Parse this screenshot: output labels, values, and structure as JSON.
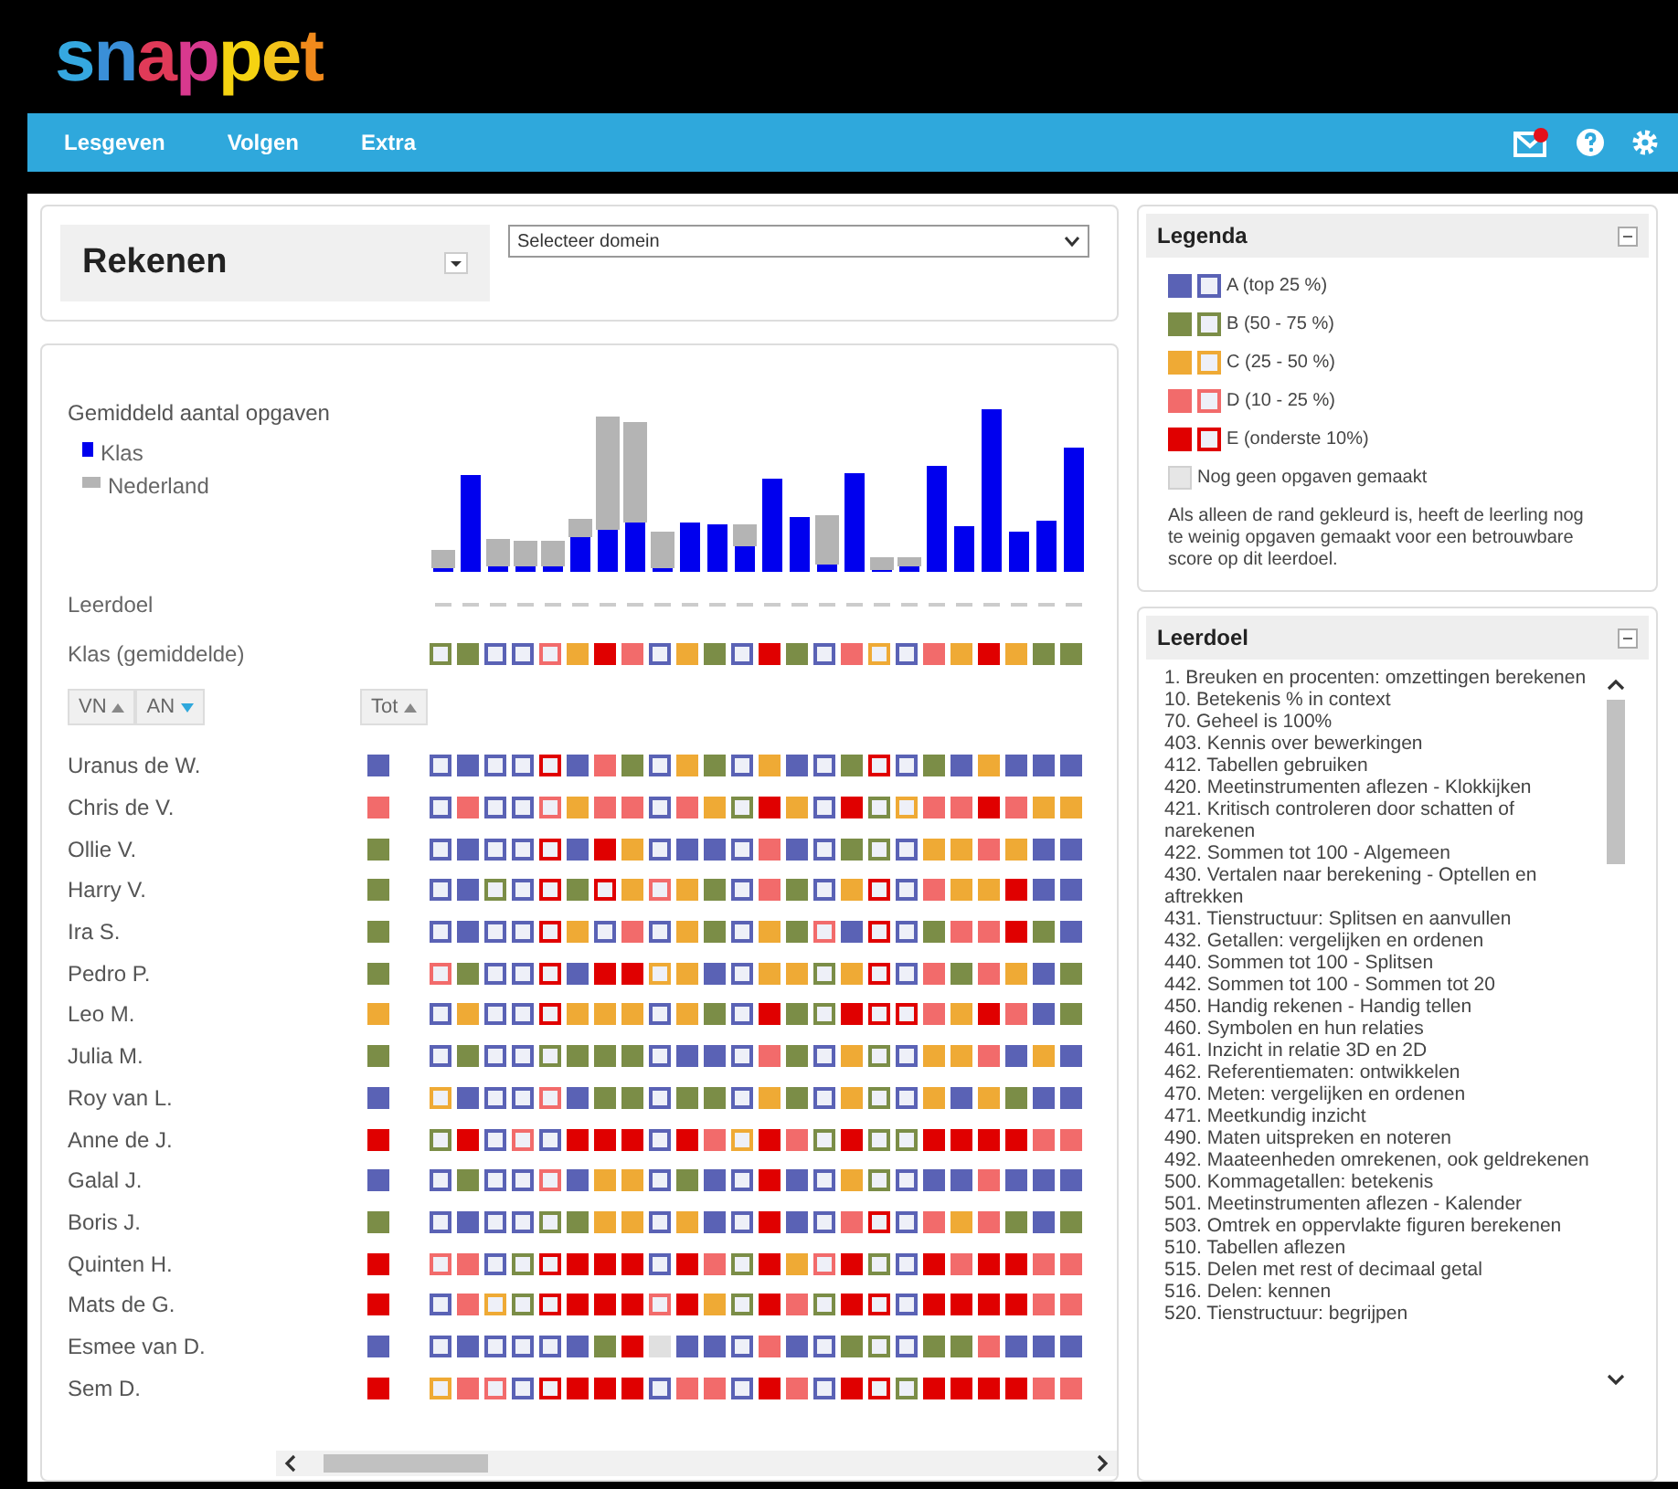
{
  "logo": "snappet",
  "nav": [
    {
      "label": "Lesgeven"
    },
    {
      "label": "Volgen"
    },
    {
      "label": "Extra"
    }
  ],
  "subject": {
    "title": "Rekenen"
  },
  "domain_select": {
    "value": "Selecteer domein"
  },
  "chart_legend": {
    "title": "Gemiddeld aantal opgaven",
    "series": [
      {
        "name": "Klas",
        "color": "#0000ee"
      },
      {
        "name": "Nederland",
        "color": "#b4b4b4"
      }
    ]
  },
  "row_labels": {
    "goal": "Leerdoel",
    "class_avg": "Klas (gemiddelde)"
  },
  "class_avg": [
    {
      "color": "#7b8d47",
      "filled": false
    },
    {
      "color": "#7b8d47",
      "filled": true
    },
    {
      "color": "#5a62b5",
      "filled": false
    },
    {
      "color": "#5a62b5",
      "filled": false
    },
    {
      "color": "#f26b6b",
      "filled": false
    },
    {
      "color": "#efaa35",
      "filled": true
    },
    {
      "color": "#e00000",
      "filled": true
    },
    {
      "color": "#f26b6b",
      "filled": true
    },
    {
      "color": "#5a62b5",
      "filled": false
    },
    {
      "color": "#efaa35",
      "filled": true
    },
    {
      "color": "#7b8d47",
      "filled": true
    },
    {
      "color": "#5a62b5",
      "filled": false
    },
    {
      "color": "#e00000",
      "filled": true
    },
    {
      "color": "#7b8d47",
      "filled": true
    },
    {
      "color": "#5a62b5",
      "filled": false
    },
    {
      "color": "#f26b6b",
      "filled": true
    },
    {
      "color": "#efaa35",
      "filled": false
    },
    {
      "color": "#5a62b5",
      "filled": false
    },
    {
      "color": "#f26b6b",
      "filled": true
    },
    {
      "color": "#efaa35",
      "filled": true
    },
    {
      "color": "#e00000",
      "filled": true
    },
    {
      "color": "#efaa35",
      "filled": true
    },
    {
      "color": "#7b8d47",
      "filled": true
    },
    {
      "color": "#7b8d47",
      "filled": true
    }
  ],
  "sort_buttons": [
    {
      "label": "VN",
      "selected": false
    },
    {
      "label": "AN",
      "selected": true
    }
  ],
  "total_header": "Tot",
  "students": [
    {
      "name": "Uranus de W.",
      "total": {
        "color": "#5a62b5"
      },
      "cells": [
        {
          "color": "#5a62b5",
          "filled": false
        },
        {
          "color": "#5a62b5",
          "filled": true
        },
        {
          "color": "#5a62b5",
          "filled": false
        },
        {
          "color": "#5a62b5",
          "filled": false
        },
        {
          "color": "#e00000",
          "filled": false
        },
        {
          "color": "#5a62b5",
          "filled": true
        },
        {
          "color": "#f26b6b",
          "filled": true
        },
        {
          "color": "#7b8d47",
          "filled": true
        },
        {
          "color": "#5a62b5",
          "filled": false
        },
        {
          "color": "#efaa35",
          "filled": true
        },
        {
          "color": "#7b8d47",
          "filled": true
        },
        {
          "color": "#5a62b5",
          "filled": false
        },
        {
          "color": "#efaa35",
          "filled": true
        },
        {
          "color": "#5a62b5",
          "filled": true
        },
        {
          "color": "#5a62b5",
          "filled": false
        },
        {
          "color": "#7b8d47",
          "filled": true
        },
        {
          "color": "#e00000",
          "filled": false
        },
        {
          "color": "#5a62b5",
          "filled": false
        },
        {
          "color": "#7b8d47",
          "filled": true
        },
        {
          "color": "#5a62b5",
          "filled": true
        },
        {
          "color": "#efaa35",
          "filled": true
        },
        {
          "color": "#5a62b5",
          "filled": true
        },
        {
          "color": "#5a62b5",
          "filled": true
        },
        {
          "color": "#5a62b5",
          "filled": true
        }
      ]
    },
    {
      "name": "Chris de V.",
      "total": {
        "color": "#f26b6b"
      },
      "cells": [
        {
          "color": "#5a62b5",
          "filled": false
        },
        {
          "color": "#f26b6b",
          "filled": true
        },
        {
          "color": "#5a62b5",
          "filled": false
        },
        {
          "color": "#5a62b5",
          "filled": false
        },
        {
          "color": "#f26b6b",
          "filled": false
        },
        {
          "color": "#efaa35",
          "filled": true
        },
        {
          "color": "#f26b6b",
          "filled": true
        },
        {
          "color": "#f26b6b",
          "filled": true
        },
        {
          "color": "#5a62b5",
          "filled": false
        },
        {
          "color": "#f26b6b",
          "filled": true
        },
        {
          "color": "#efaa35",
          "filled": true
        },
        {
          "color": "#7b8d47",
          "filled": false
        },
        {
          "color": "#e00000",
          "filled": true
        },
        {
          "color": "#efaa35",
          "filled": true
        },
        {
          "color": "#5a62b5",
          "filled": false
        },
        {
          "color": "#e00000",
          "filled": true
        },
        {
          "color": "#7b8d47",
          "filled": false
        },
        {
          "color": "#efaa35",
          "filled": false
        },
        {
          "color": "#f26b6b",
          "filled": true
        },
        {
          "color": "#f26b6b",
          "filled": true
        },
        {
          "color": "#e00000",
          "filled": true
        },
        {
          "color": "#f26b6b",
          "filled": true
        },
        {
          "color": "#efaa35",
          "filled": true
        },
        {
          "color": "#efaa35",
          "filled": true
        }
      ]
    },
    {
      "name": "Ollie V.",
      "total": {
        "color": "#7b8d47"
      },
      "cells": [
        {
          "color": "#5a62b5",
          "filled": false
        },
        {
          "color": "#5a62b5",
          "filled": true
        },
        {
          "color": "#5a62b5",
          "filled": false
        },
        {
          "color": "#5a62b5",
          "filled": false
        },
        {
          "color": "#e00000",
          "filled": false
        },
        {
          "color": "#5a62b5",
          "filled": true
        },
        {
          "color": "#e00000",
          "filled": true
        },
        {
          "color": "#efaa35",
          "filled": true
        },
        {
          "color": "#5a62b5",
          "filled": false
        },
        {
          "color": "#5a62b5",
          "filled": true
        },
        {
          "color": "#5a62b5",
          "filled": true
        },
        {
          "color": "#5a62b5",
          "filled": false
        },
        {
          "color": "#f26b6b",
          "filled": true
        },
        {
          "color": "#5a62b5",
          "filled": true
        },
        {
          "color": "#5a62b5",
          "filled": false
        },
        {
          "color": "#7b8d47",
          "filled": true
        },
        {
          "color": "#7b8d47",
          "filled": false
        },
        {
          "color": "#5a62b5",
          "filled": false
        },
        {
          "color": "#efaa35",
          "filled": true
        },
        {
          "color": "#efaa35",
          "filled": true
        },
        {
          "color": "#f26b6b",
          "filled": true
        },
        {
          "color": "#efaa35",
          "filled": true
        },
        {
          "color": "#5a62b5",
          "filled": true
        },
        {
          "color": "#5a62b5",
          "filled": true
        }
      ]
    },
    {
      "name": "Harry V.",
      "total": {
        "color": "#7b8d47"
      },
      "cells": [
        {
          "color": "#5a62b5",
          "filled": false
        },
        {
          "color": "#5a62b5",
          "filled": true
        },
        {
          "color": "#7b8d47",
          "filled": false
        },
        {
          "color": "#5a62b5",
          "filled": false
        },
        {
          "color": "#e00000",
          "filled": false
        },
        {
          "color": "#7b8d47",
          "filled": true
        },
        {
          "color": "#e00000",
          "filled": false
        },
        {
          "color": "#efaa35",
          "filled": true
        },
        {
          "color": "#f26b6b",
          "filled": false
        },
        {
          "color": "#efaa35",
          "filled": true
        },
        {
          "color": "#7b8d47",
          "filled": true
        },
        {
          "color": "#5a62b5",
          "filled": false
        },
        {
          "color": "#f26b6b",
          "filled": true
        },
        {
          "color": "#7b8d47",
          "filled": true
        },
        {
          "color": "#5a62b5",
          "filled": false
        },
        {
          "color": "#efaa35",
          "filled": true
        },
        {
          "color": "#e00000",
          "filled": false
        },
        {
          "color": "#5a62b5",
          "filled": false
        },
        {
          "color": "#f26b6b",
          "filled": true
        },
        {
          "color": "#efaa35",
          "filled": true
        },
        {
          "color": "#efaa35",
          "filled": true
        },
        {
          "color": "#e00000",
          "filled": true
        },
        {
          "color": "#5a62b5",
          "filled": true
        },
        {
          "color": "#5a62b5",
          "filled": true
        }
      ]
    },
    {
      "name": "Ira S.",
      "total": {
        "color": "#7b8d47"
      },
      "cells": [
        {
          "color": "#5a62b5",
          "filled": false
        },
        {
          "color": "#5a62b5",
          "filled": true
        },
        {
          "color": "#5a62b5",
          "filled": false
        },
        {
          "color": "#5a62b5",
          "filled": false
        },
        {
          "color": "#e00000",
          "filled": false
        },
        {
          "color": "#efaa35",
          "filled": true
        },
        {
          "color": "#5a62b5",
          "filled": false
        },
        {
          "color": "#f26b6b",
          "filled": true
        },
        {
          "color": "#5a62b5",
          "filled": false
        },
        {
          "color": "#efaa35",
          "filled": true
        },
        {
          "color": "#7b8d47",
          "filled": true
        },
        {
          "color": "#5a62b5",
          "filled": false
        },
        {
          "color": "#efaa35",
          "filled": true
        },
        {
          "color": "#7b8d47",
          "filled": true
        },
        {
          "color": "#f26b6b",
          "filled": false
        },
        {
          "color": "#5a62b5",
          "filled": true
        },
        {
          "color": "#e00000",
          "filled": false
        },
        {
          "color": "#5a62b5",
          "filled": false
        },
        {
          "color": "#7b8d47",
          "filled": true
        },
        {
          "color": "#f26b6b",
          "filled": true
        },
        {
          "color": "#f26b6b",
          "filled": true
        },
        {
          "color": "#e00000",
          "filled": true
        },
        {
          "color": "#7b8d47",
          "filled": true
        },
        {
          "color": "#5a62b5",
          "filled": true
        }
      ]
    },
    {
      "name": "Pedro P.",
      "total": {
        "color": "#7b8d47"
      },
      "cells": [
        {
          "color": "#f26b6b",
          "filled": false
        },
        {
          "color": "#7b8d47",
          "filled": true
        },
        {
          "color": "#5a62b5",
          "filled": false
        },
        {
          "color": "#5a62b5",
          "filled": false
        },
        {
          "color": "#e00000",
          "filled": false
        },
        {
          "color": "#5a62b5",
          "filled": true
        },
        {
          "color": "#e00000",
          "filled": true
        },
        {
          "color": "#e00000",
          "filled": true
        },
        {
          "color": "#efaa35",
          "filled": false
        },
        {
          "color": "#efaa35",
          "filled": true
        },
        {
          "color": "#5a62b5",
          "filled": true
        },
        {
          "color": "#5a62b5",
          "filled": false
        },
        {
          "color": "#efaa35",
          "filled": true
        },
        {
          "color": "#efaa35",
          "filled": true
        },
        {
          "color": "#7b8d47",
          "filled": false
        },
        {
          "color": "#efaa35",
          "filled": true
        },
        {
          "color": "#e00000",
          "filled": false
        },
        {
          "color": "#5a62b5",
          "filled": false
        },
        {
          "color": "#f26b6b",
          "filled": true
        },
        {
          "color": "#7b8d47",
          "filled": true
        },
        {
          "color": "#f26b6b",
          "filled": true
        },
        {
          "color": "#efaa35",
          "filled": true
        },
        {
          "color": "#5a62b5",
          "filled": true
        },
        {
          "color": "#7b8d47",
          "filled": true
        }
      ]
    },
    {
      "name": "Leo M.",
      "total": {
        "color": "#efaa35"
      },
      "cells": [
        {
          "color": "#5a62b5",
          "filled": false
        },
        {
          "color": "#efaa35",
          "filled": true
        },
        {
          "color": "#5a62b5",
          "filled": false
        },
        {
          "color": "#5a62b5",
          "filled": false
        },
        {
          "color": "#e00000",
          "filled": false
        },
        {
          "color": "#efaa35",
          "filled": true
        },
        {
          "color": "#efaa35",
          "filled": true
        },
        {
          "color": "#efaa35",
          "filled": true
        },
        {
          "color": "#5a62b5",
          "filled": false
        },
        {
          "color": "#efaa35",
          "filled": true
        },
        {
          "color": "#7b8d47",
          "filled": true
        },
        {
          "color": "#5a62b5",
          "filled": false
        },
        {
          "color": "#e00000",
          "filled": true
        },
        {
          "color": "#7b8d47",
          "filled": true
        },
        {
          "color": "#7b8d47",
          "filled": false
        },
        {
          "color": "#e00000",
          "filled": true
        },
        {
          "color": "#e00000",
          "filled": false
        },
        {
          "color": "#e00000",
          "filled": false
        },
        {
          "color": "#f26b6b",
          "filled": true
        },
        {
          "color": "#efaa35",
          "filled": true
        },
        {
          "color": "#e00000",
          "filled": true
        },
        {
          "color": "#f26b6b",
          "filled": true
        },
        {
          "color": "#5a62b5",
          "filled": true
        },
        {
          "color": "#7b8d47",
          "filled": true
        }
      ]
    },
    {
      "name": "Julia M.",
      "total": {
        "color": "#7b8d47"
      },
      "cells": [
        {
          "color": "#5a62b5",
          "filled": false
        },
        {
          "color": "#7b8d47",
          "filled": true
        },
        {
          "color": "#5a62b5",
          "filled": false
        },
        {
          "color": "#5a62b5",
          "filled": false
        },
        {
          "color": "#7b8d47",
          "filled": false
        },
        {
          "color": "#7b8d47",
          "filled": true
        },
        {
          "color": "#7b8d47",
          "filled": true
        },
        {
          "color": "#7b8d47",
          "filled": true
        },
        {
          "color": "#5a62b5",
          "filled": false
        },
        {
          "color": "#5a62b5",
          "filled": true
        },
        {
          "color": "#5a62b5",
          "filled": true
        },
        {
          "color": "#5a62b5",
          "filled": false
        },
        {
          "color": "#f26b6b",
          "filled": true
        },
        {
          "color": "#7b8d47",
          "filled": true
        },
        {
          "color": "#5a62b5",
          "filled": false
        },
        {
          "color": "#efaa35",
          "filled": true
        },
        {
          "color": "#7b8d47",
          "filled": false
        },
        {
          "color": "#5a62b5",
          "filled": false
        },
        {
          "color": "#efaa35",
          "filled": true
        },
        {
          "color": "#efaa35",
          "filled": true
        },
        {
          "color": "#f26b6b",
          "filled": true
        },
        {
          "color": "#5a62b5",
          "filled": true
        },
        {
          "color": "#efaa35",
          "filled": true
        },
        {
          "color": "#5a62b5",
          "filled": true
        }
      ]
    },
    {
      "name": "Roy van L.",
      "total": {
        "color": "#5a62b5"
      },
      "cells": [
        {
          "color": "#efaa35",
          "filled": false
        },
        {
          "color": "#5a62b5",
          "filled": true
        },
        {
          "color": "#5a62b5",
          "filled": false
        },
        {
          "color": "#5a62b5",
          "filled": false
        },
        {
          "color": "#f26b6b",
          "filled": false
        },
        {
          "color": "#5a62b5",
          "filled": true
        },
        {
          "color": "#7b8d47",
          "filled": true
        },
        {
          "color": "#7b8d47",
          "filled": true
        },
        {
          "color": "#5a62b5",
          "filled": false
        },
        {
          "color": "#7b8d47",
          "filled": true
        },
        {
          "color": "#7b8d47",
          "filled": true
        },
        {
          "color": "#5a62b5",
          "filled": false
        },
        {
          "color": "#efaa35",
          "filled": true
        },
        {
          "color": "#7b8d47",
          "filled": true
        },
        {
          "color": "#5a62b5",
          "filled": false
        },
        {
          "color": "#efaa35",
          "filled": true
        },
        {
          "color": "#7b8d47",
          "filled": false
        },
        {
          "color": "#5a62b5",
          "filled": false
        },
        {
          "color": "#efaa35",
          "filled": true
        },
        {
          "color": "#5a62b5",
          "filled": true
        },
        {
          "color": "#efaa35",
          "filled": true
        },
        {
          "color": "#7b8d47",
          "filled": true
        },
        {
          "color": "#5a62b5",
          "filled": true
        },
        {
          "color": "#5a62b5",
          "filled": true
        }
      ]
    },
    {
      "name": "Anne de J.",
      "total": {
        "color": "#e00000"
      },
      "cells": [
        {
          "color": "#7b8d47",
          "filled": false
        },
        {
          "color": "#e00000",
          "filled": true
        },
        {
          "color": "#5a62b5",
          "filled": false
        },
        {
          "color": "#f26b6b",
          "filled": false
        },
        {
          "color": "#5a62b5",
          "filled": false
        },
        {
          "color": "#e00000",
          "filled": true
        },
        {
          "color": "#e00000",
          "filled": true
        },
        {
          "color": "#e00000",
          "filled": true
        },
        {
          "color": "#5a62b5",
          "filled": false
        },
        {
          "color": "#e00000",
          "filled": true
        },
        {
          "color": "#f26b6b",
          "filled": true
        },
        {
          "color": "#efaa35",
          "filled": false
        },
        {
          "color": "#e00000",
          "filled": true
        },
        {
          "color": "#f26b6b",
          "filled": true
        },
        {
          "color": "#7b8d47",
          "filled": false
        },
        {
          "color": "#e00000",
          "filled": true
        },
        {
          "color": "#7b8d47",
          "filled": false
        },
        {
          "color": "#7b8d47",
          "filled": false
        },
        {
          "color": "#e00000",
          "filled": true
        },
        {
          "color": "#e00000",
          "filled": true
        },
        {
          "color": "#e00000",
          "filled": true
        },
        {
          "color": "#e00000",
          "filled": true
        },
        {
          "color": "#f26b6b",
          "filled": true
        },
        {
          "color": "#f26b6b",
          "filled": true
        }
      ]
    },
    {
      "name": "Galal J.",
      "total": {
        "color": "#5a62b5"
      },
      "cells": [
        {
          "color": "#5a62b5",
          "filled": false
        },
        {
          "color": "#7b8d47",
          "filled": true
        },
        {
          "color": "#5a62b5",
          "filled": false
        },
        {
          "color": "#5a62b5",
          "filled": false
        },
        {
          "color": "#f26b6b",
          "filled": false
        },
        {
          "color": "#5a62b5",
          "filled": true
        },
        {
          "color": "#efaa35",
          "filled": true
        },
        {
          "color": "#efaa35",
          "filled": true
        },
        {
          "color": "#5a62b5",
          "filled": false
        },
        {
          "color": "#7b8d47",
          "filled": true
        },
        {
          "color": "#5a62b5",
          "filled": true
        },
        {
          "color": "#5a62b5",
          "filled": false
        },
        {
          "color": "#e00000",
          "filled": true
        },
        {
          "color": "#5a62b5",
          "filled": true
        },
        {
          "color": "#5a62b5",
          "filled": false
        },
        {
          "color": "#efaa35",
          "filled": true
        },
        {
          "color": "#7b8d47",
          "filled": false
        },
        {
          "color": "#5a62b5",
          "filled": false
        },
        {
          "color": "#5a62b5",
          "filled": true
        },
        {
          "color": "#5a62b5",
          "filled": true
        },
        {
          "color": "#f26b6b",
          "filled": true
        },
        {
          "color": "#5a62b5",
          "filled": true
        },
        {
          "color": "#5a62b5",
          "filled": true
        },
        {
          "color": "#5a62b5",
          "filled": true
        }
      ]
    },
    {
      "name": "Boris J.",
      "total": {
        "color": "#7b8d47"
      },
      "cells": [
        {
          "color": "#5a62b5",
          "filled": false
        },
        {
          "color": "#5a62b5",
          "filled": true
        },
        {
          "color": "#5a62b5",
          "filled": false
        },
        {
          "color": "#5a62b5",
          "filled": false
        },
        {
          "color": "#7b8d47",
          "filled": false
        },
        {
          "color": "#7b8d47",
          "filled": true
        },
        {
          "color": "#efaa35",
          "filled": true
        },
        {
          "color": "#efaa35",
          "filled": true
        },
        {
          "color": "#5a62b5",
          "filled": false
        },
        {
          "color": "#efaa35",
          "filled": true
        },
        {
          "color": "#5a62b5",
          "filled": true
        },
        {
          "color": "#5a62b5",
          "filled": false
        },
        {
          "color": "#e00000",
          "filled": true
        },
        {
          "color": "#5a62b5",
          "filled": true
        },
        {
          "color": "#5a62b5",
          "filled": false
        },
        {
          "color": "#f26b6b",
          "filled": true
        },
        {
          "color": "#e00000",
          "filled": false
        },
        {
          "color": "#5a62b5",
          "filled": false
        },
        {
          "color": "#f26b6b",
          "filled": true
        },
        {
          "color": "#efaa35",
          "filled": true
        },
        {
          "color": "#f26b6b",
          "filled": true
        },
        {
          "color": "#7b8d47",
          "filled": true
        },
        {
          "color": "#5a62b5",
          "filled": true
        },
        {
          "color": "#7b8d47",
          "filled": true
        }
      ]
    },
    {
      "name": "Quinten H.",
      "total": {
        "color": "#e00000"
      },
      "cells": [
        {
          "color": "#f26b6b",
          "filled": false
        },
        {
          "color": "#f26b6b",
          "filled": true
        },
        {
          "color": "#5a62b5",
          "filled": false
        },
        {
          "color": "#7b8d47",
          "filled": false
        },
        {
          "color": "#e00000",
          "filled": false
        },
        {
          "color": "#e00000",
          "filled": true
        },
        {
          "color": "#e00000",
          "filled": true
        },
        {
          "color": "#e00000",
          "filled": true
        },
        {
          "color": "#5a62b5",
          "filled": false
        },
        {
          "color": "#e00000",
          "filled": true
        },
        {
          "color": "#f26b6b",
          "filled": true
        },
        {
          "color": "#7b8d47",
          "filled": false
        },
        {
          "color": "#e00000",
          "filled": true
        },
        {
          "color": "#efaa35",
          "filled": true
        },
        {
          "color": "#f26b6b",
          "filled": false
        },
        {
          "color": "#e00000",
          "filled": true
        },
        {
          "color": "#7b8d47",
          "filled": false
        },
        {
          "color": "#5a62b5",
          "filled": false
        },
        {
          "color": "#e00000",
          "filled": true
        },
        {
          "color": "#f26b6b",
          "filled": true
        },
        {
          "color": "#e00000",
          "filled": true
        },
        {
          "color": "#e00000",
          "filled": true
        },
        {
          "color": "#f26b6b",
          "filled": true
        },
        {
          "color": "#f26b6b",
          "filled": true
        }
      ]
    },
    {
      "name": "Mats de G.",
      "total": {
        "color": "#e00000"
      },
      "cells": [
        {
          "color": "#5a62b5",
          "filled": false
        },
        {
          "color": "#f26b6b",
          "filled": true
        },
        {
          "color": "#efaa35",
          "filled": false
        },
        {
          "color": "#7b8d47",
          "filled": false
        },
        {
          "color": "#e00000",
          "filled": false
        },
        {
          "color": "#e00000",
          "filled": true
        },
        {
          "color": "#e00000",
          "filled": true
        },
        {
          "color": "#e00000",
          "filled": true
        },
        {
          "color": "#f26b6b",
          "filled": false
        },
        {
          "color": "#e00000",
          "filled": true
        },
        {
          "color": "#efaa35",
          "filled": true
        },
        {
          "color": "#7b8d47",
          "filled": false
        },
        {
          "color": "#e00000",
          "filled": true
        },
        {
          "color": "#f26b6b",
          "filled": true
        },
        {
          "color": "#7b8d47",
          "filled": false
        },
        {
          "color": "#e00000",
          "filled": true
        },
        {
          "color": "#e00000",
          "filled": false
        },
        {
          "color": "#5a62b5",
          "filled": false
        },
        {
          "color": "#e00000",
          "filled": true
        },
        {
          "color": "#e00000",
          "filled": true
        },
        {
          "color": "#e00000",
          "filled": true
        },
        {
          "color": "#e00000",
          "filled": true
        },
        {
          "color": "#f26b6b",
          "filled": true
        },
        {
          "color": "#f26b6b",
          "filled": true
        }
      ]
    },
    {
      "name": "Esmee van D.",
      "total": {
        "color": "#5a62b5"
      },
      "cells": [
        {
          "color": "#5a62b5",
          "filled": false
        },
        {
          "color": "#5a62b5",
          "filled": true
        },
        {
          "color": "#5a62b5",
          "filled": false
        },
        {
          "color": "#5a62b5",
          "filled": false
        },
        {
          "color": "#5a62b5",
          "filled": false
        },
        {
          "color": "#5a62b5",
          "filled": true
        },
        {
          "color": "#7b8d47",
          "filled": true
        },
        {
          "color": "#e00000",
          "filled": true
        },
        {
          "color": "#e0e0e0",
          "filled": true
        },
        {
          "color": "#5a62b5",
          "filled": true
        },
        {
          "color": "#5a62b5",
          "filled": true
        },
        {
          "color": "#5a62b5",
          "filled": false
        },
        {
          "color": "#f26b6b",
          "filled": true
        },
        {
          "color": "#5a62b5",
          "filled": true
        },
        {
          "color": "#5a62b5",
          "filled": false
        },
        {
          "color": "#7b8d47",
          "filled": true
        },
        {
          "color": "#7b8d47",
          "filled": false
        },
        {
          "color": "#5a62b5",
          "filled": false
        },
        {
          "color": "#7b8d47",
          "filled": true
        },
        {
          "color": "#7b8d47",
          "filled": true
        },
        {
          "color": "#f26b6b",
          "filled": true
        },
        {
          "color": "#5a62b5",
          "filled": true
        },
        {
          "color": "#5a62b5",
          "filled": true
        },
        {
          "color": "#5a62b5",
          "filled": true
        }
      ]
    },
    {
      "name": "Sem D.",
      "total": {
        "color": "#e00000"
      },
      "cells": [
        {
          "color": "#efaa35",
          "filled": false
        },
        {
          "color": "#f26b6b",
          "filled": true
        },
        {
          "color": "#f26b6b",
          "filled": false
        },
        {
          "color": "#5a62b5",
          "filled": false
        },
        {
          "color": "#e00000",
          "filled": false
        },
        {
          "color": "#e00000",
          "filled": true
        },
        {
          "color": "#e00000",
          "filled": true
        },
        {
          "color": "#e00000",
          "filled": true
        },
        {
          "color": "#5a62b5",
          "filled": false
        },
        {
          "color": "#f26b6b",
          "filled": true
        },
        {
          "color": "#f26b6b",
          "filled": true
        },
        {
          "color": "#5a62b5",
          "filled": false
        },
        {
          "color": "#e00000",
          "filled": true
        },
        {
          "color": "#f26b6b",
          "filled": true
        },
        {
          "color": "#5a62b5",
          "filled": false
        },
        {
          "color": "#e00000",
          "filled": true
        },
        {
          "color": "#e00000",
          "filled": false
        },
        {
          "color": "#7b8d47",
          "filled": false
        },
        {
          "color": "#e00000",
          "filled": true
        },
        {
          "color": "#e00000",
          "filled": true
        },
        {
          "color": "#e00000",
          "filled": true
        },
        {
          "color": "#e00000",
          "filled": true
        },
        {
          "color": "#f26b6b",
          "filled": true
        },
        {
          "color": "#f26b6b",
          "filled": true
        }
      ]
    }
  ],
  "legend": {
    "title": "Legenda",
    "levels": [
      {
        "color": "#5a62b5",
        "text": "A (top 25 %)"
      },
      {
        "color": "#7b8d47",
        "text": "B (50 - 75 %)"
      },
      {
        "color": "#efaa35",
        "text": "C (25 - 50 %)"
      },
      {
        "color": "#f26b6b",
        "text": "D (10 - 25 %)"
      },
      {
        "color": "#e00000",
        "text": "E (onderste 10%)"
      }
    ],
    "none_text": "Nog geen opgaven gemaakt",
    "note": "Als alleen de rand gekleurd is, heeft de leerling nog te weinig opgaven gemaakt voor een betrouwbare score op dit leerdoel."
  },
  "goals": {
    "title": "Leerdoel",
    "items": [
      "1. Breuken en procenten: omzettingen berekenen",
      "10. Betekenis % in context",
      "70. Geheel is 100%",
      "403. Kennis over bewerkingen",
      "412. Tabellen gebruiken",
      "420. Meetinstrumenten aflezen - Klokkijken",
      "421. Kritisch controleren door schatten of narekenen",
      "422. Sommen tot 100 - Algemeen",
      "430. Vertalen naar berekening - Optellen en aftrekken",
      "431. Tienstructuur: Splitsen en aanvullen",
      "432. Getallen: vergelijken en ordenen",
      "440. Sommen tot 100 - Splitsen",
      "442. Sommen tot 100 - Sommen tot 20",
      "450. Handig rekenen - Handig tellen",
      "460. Symbolen en hun relaties",
      "461. Inzicht in relatie 3D en 2D",
      "462. Referentiematen: ontwikkelen",
      "470. Meten: vergelijken en ordenen",
      "471. Meetkundig inzicht",
      "490. Maten uitspreken en noteren",
      "492. Maateenheden omrekenen, ook geldrekenen",
      "500. Kommagetallen: betekenis",
      "501. Meetinstrumenten aflezen - Kalender",
      "503. Omtrek en oppervlakte figuren berekenen",
      "510. Tabellen aflezen",
      "515. Delen met rest of decimaal getal",
      "516. Delen: kennen",
      "520. Tienstructuur: begrijpen"
    ]
  }
}
